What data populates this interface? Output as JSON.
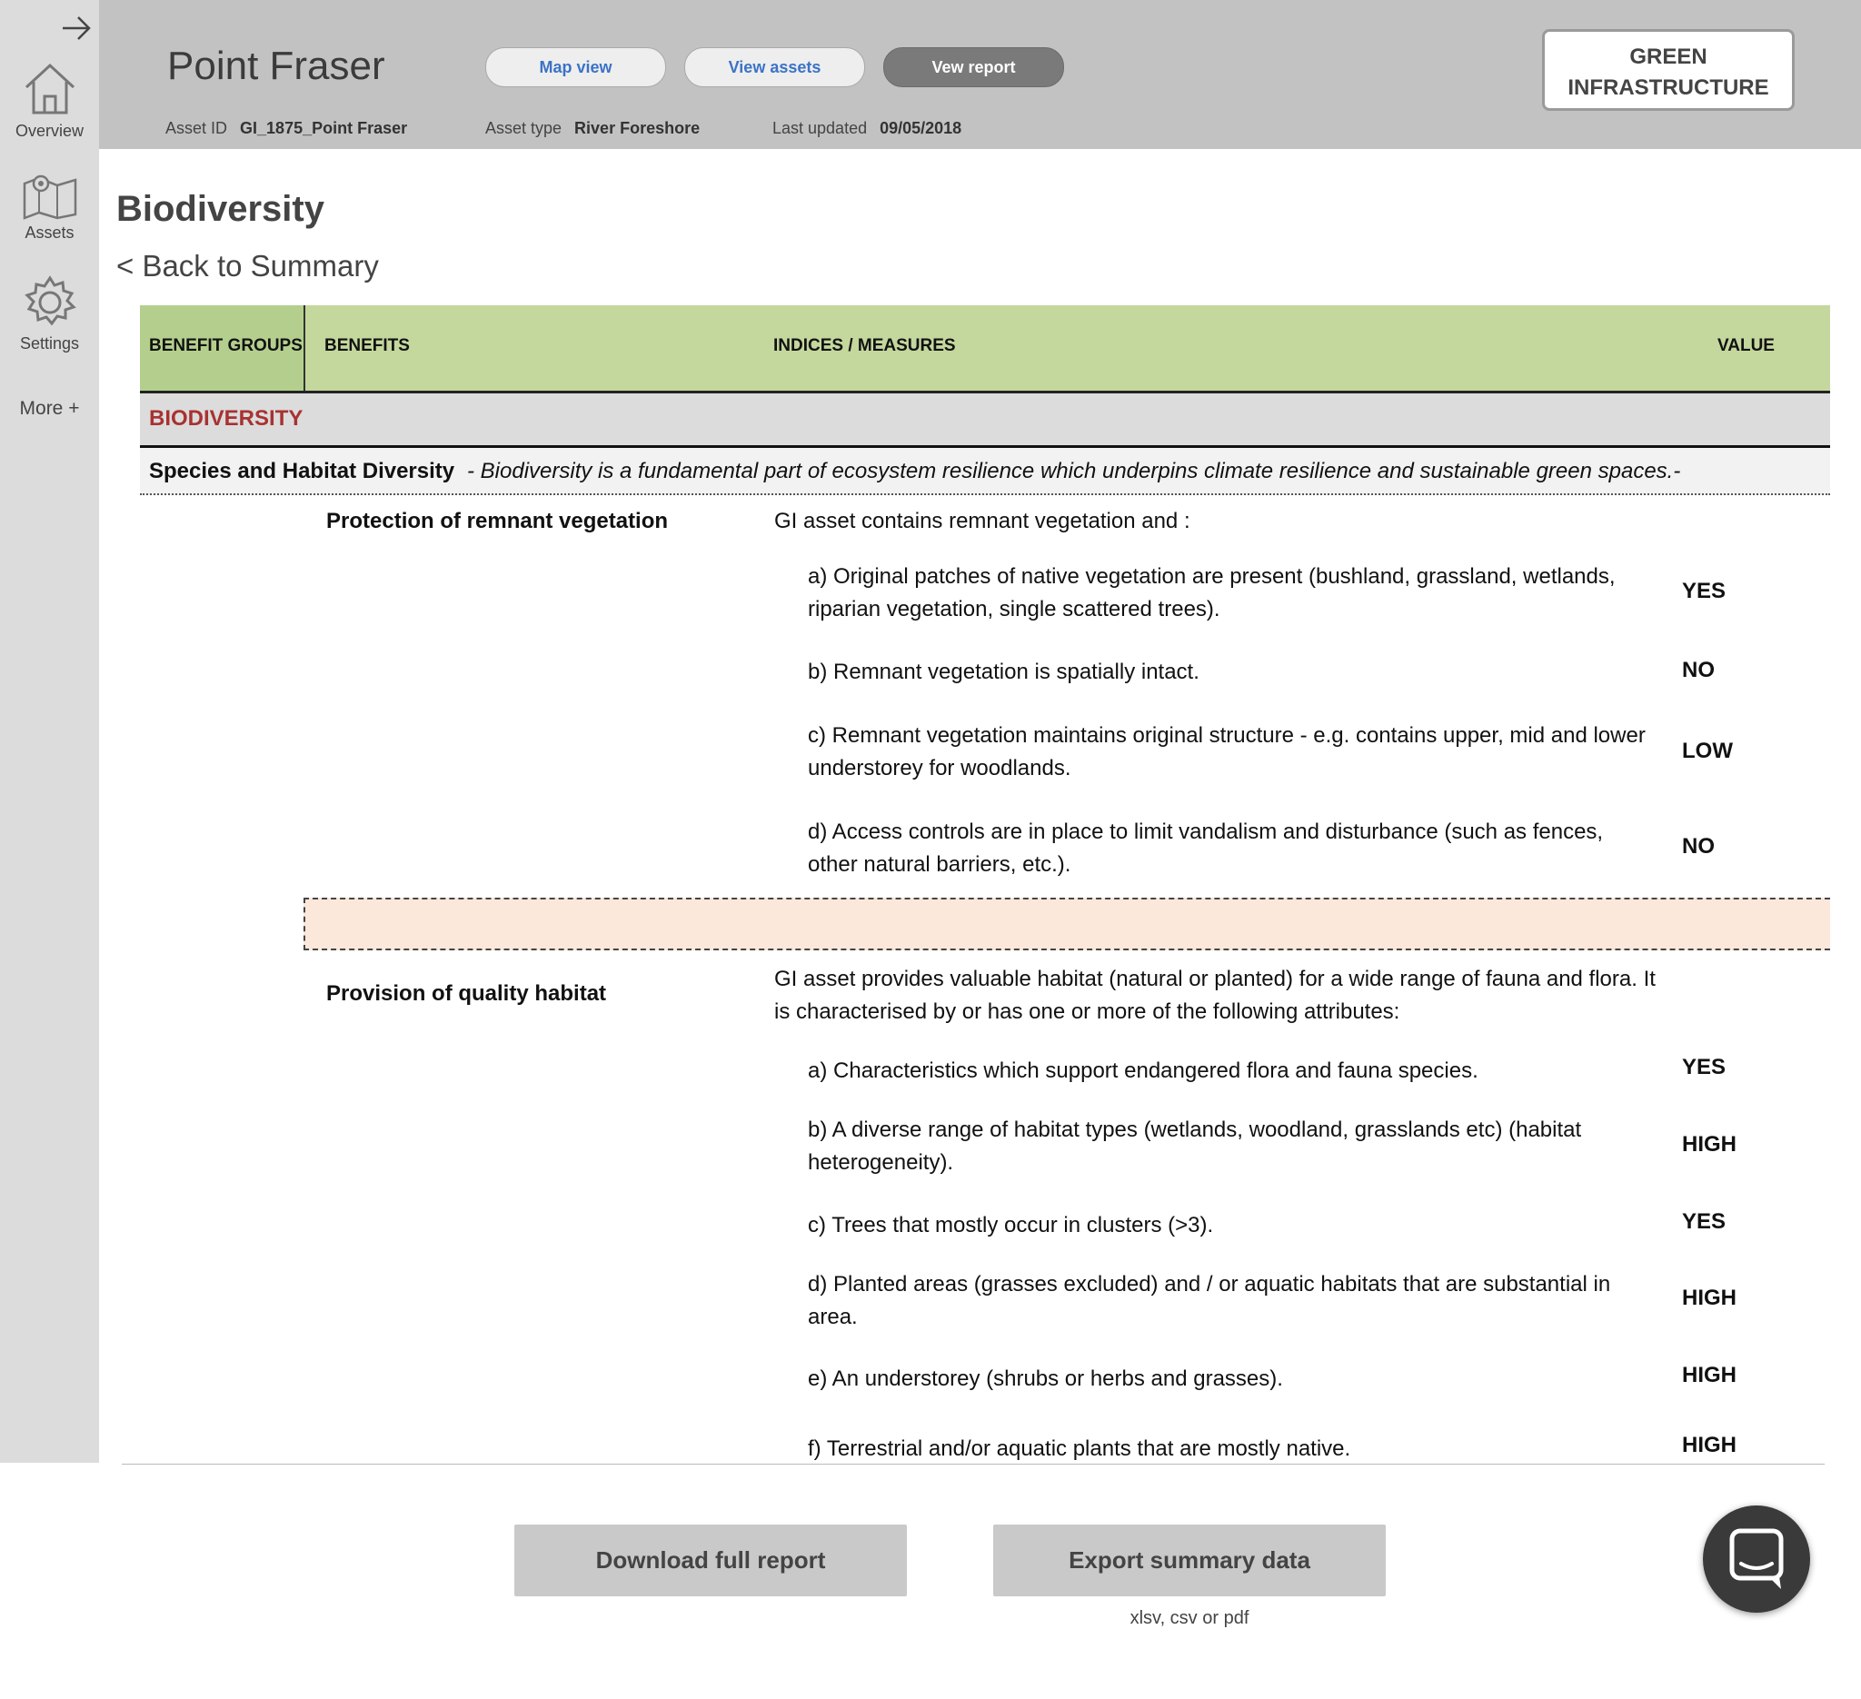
{
  "sidebar": {
    "items": [
      {
        "label": "Overview",
        "icon": "home-icon"
      },
      {
        "label": "Assets",
        "icon": "map-icon"
      },
      {
        "label": "Settings",
        "icon": "gear-icon"
      }
    ],
    "more_label": "More +"
  },
  "header": {
    "title": "Point Fraser",
    "buttons": {
      "map_view": "Map view",
      "view_assets": "View assets",
      "view_report": "Vew report"
    },
    "asset_id_label": "Asset ID",
    "asset_id_value": "GI_1875_Point Fraser",
    "asset_type_label": "Asset type",
    "asset_type_value": "River Foreshore",
    "last_updated_label": "Last updated",
    "last_updated_value": "09/05/2018",
    "badge_line1": "GREEN",
    "badge_line2": "INFRASTRUCTURE"
  },
  "main": {
    "section_title": "Biodiversity",
    "back_link": "< Back to Summary",
    "table": {
      "headers": {
        "groups": "BENEFIT GROUPS",
        "benefits": "BENEFITS",
        "measures": "INDICES / MEASURES",
        "value": "VALUE"
      },
      "group_name": "BIODIVERSITY",
      "category_bold": "Species and Habitat Diversity",
      "category_desc": "- Biodiversity is a fundamental part of ecosystem resilience which underpins climate resilience and sustainable green spaces.-",
      "benefit1": {
        "name": "Protection of remnant vegetation",
        "intro": "GI asset contains remnant vegetation and :",
        "rows": [
          {
            "text": "a)  Original patches of native vegetation are present  (bushland, grassland, wetlands, riparian vegetation, single scattered trees).",
            "value": "YES"
          },
          {
            "text": "b) Remnant vegetation is spatially intact.",
            "value": "NO"
          },
          {
            "text": "c) Remnant vegetation maintains original structure - e.g.  contains upper, mid and lower understorey for woodlands.",
            "value": "LOW"
          },
          {
            "text": "d) Access controls are in place to limit vandalism and disturbance (such as fences, other natural barriers, etc.).",
            "value": "NO"
          }
        ]
      },
      "benefit2": {
        "name": "Provision of  quality habitat",
        "intro": "GI asset provides valuable habitat (natural or planted) for a wide range of fauna and flora. It is characterised by or has one or more of the following attributes:",
        "rows": [
          {
            "text": "a) Characteristics which support endangered flora and fauna species.",
            "value": "YES"
          },
          {
            "text": "b) A diverse range of habitat types (wetlands, woodland, grasslands etc) (habitat heterogeneity).",
            "value": "HIGH"
          },
          {
            "text": "c) Trees that mostly occur in clusters (>3).",
            "value": "YES"
          },
          {
            "text": "d) Planted areas (grasses excluded) and / or aquatic habitats that are substantial in area.",
            "value": "HIGH"
          },
          {
            "text": "e) An understorey (shrubs or herbs and grasses).",
            "value": "HIGH"
          },
          {
            "text": "f) Terrestrial and/or aquatic plants that are mostly native.",
            "value": "HIGH"
          }
        ]
      }
    }
  },
  "footer": {
    "download_label": "Download full report",
    "export_label": "Export summary data",
    "export_hint": "xlsv, csv or pdf",
    "chat_icon": "chat-icon"
  },
  "colors": {
    "sidebar": "#dcdcdc",
    "header": "#c2c2c2",
    "table_header": "#c4d79d",
    "group_text": "#a83232",
    "separator": "#fce8db",
    "link_blue": "#3b73c7"
  }
}
